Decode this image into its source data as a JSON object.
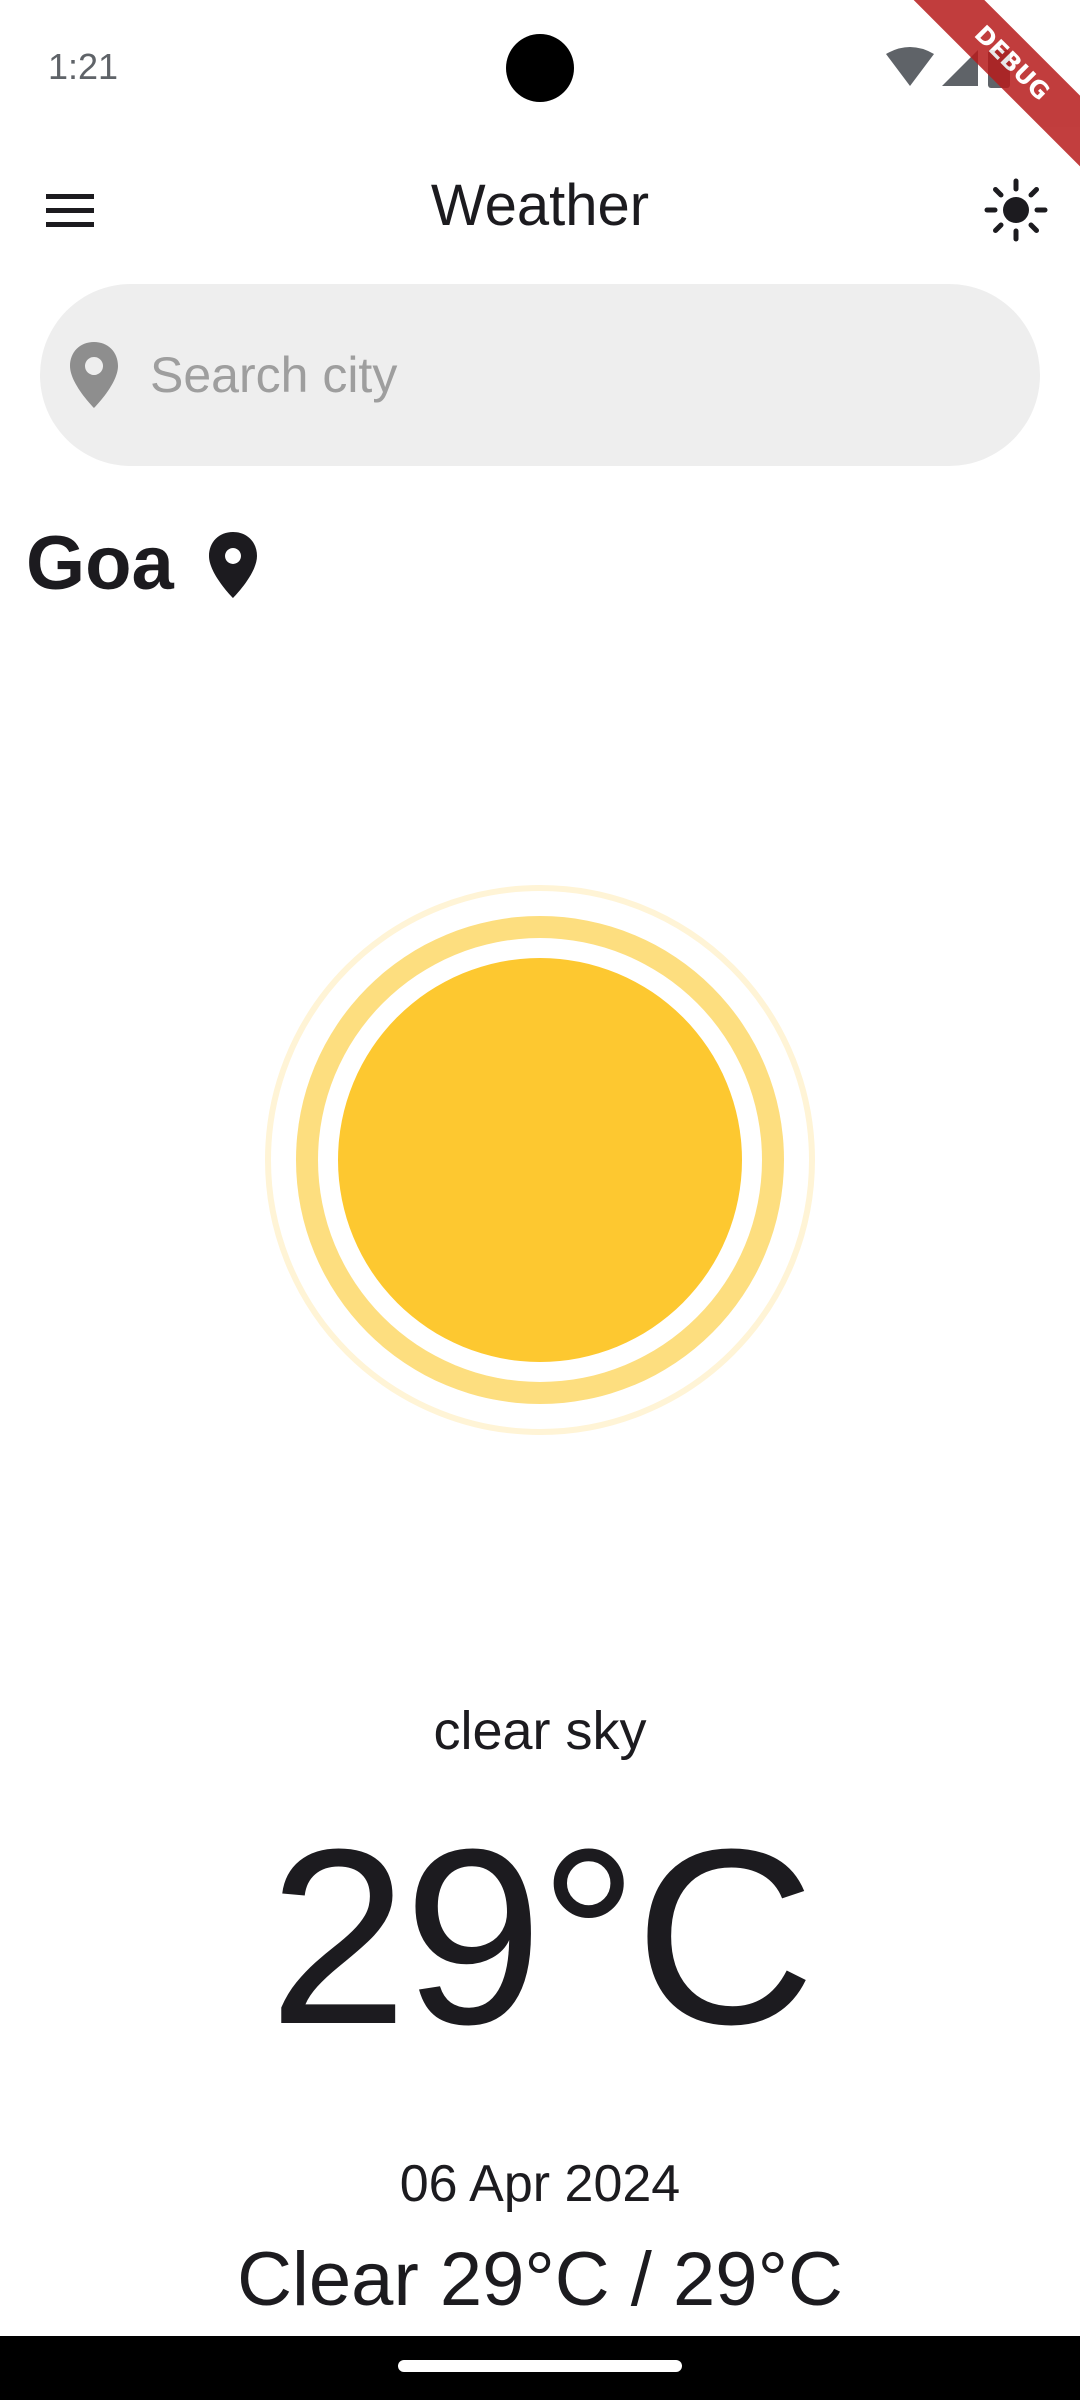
{
  "status_bar": {
    "time": "1:21",
    "debug_label": "DEBUG"
  },
  "app_bar": {
    "title": "Weather",
    "menu_icon": "menu-icon",
    "theme_icon": "sun-icon"
  },
  "search": {
    "placeholder": "Search city",
    "value": "",
    "icon": "location-pin-icon"
  },
  "city": {
    "name": "Goa",
    "icon": "location-pin-icon"
  },
  "weather": {
    "icon": "sun-icon",
    "condition": "clear sky",
    "temperature": "29°C",
    "date": "06 Apr 2024",
    "summary": "Clear 29°C / 29°C"
  },
  "colors": {
    "sun": "#fdc830",
    "sun_ring_inner": "#fdde7f",
    "sun_ring_outer": "#fff4d6",
    "search_bg": "#eeeeee",
    "text": "#1c1b1f",
    "debug_ribbon": "#b71c1c"
  }
}
